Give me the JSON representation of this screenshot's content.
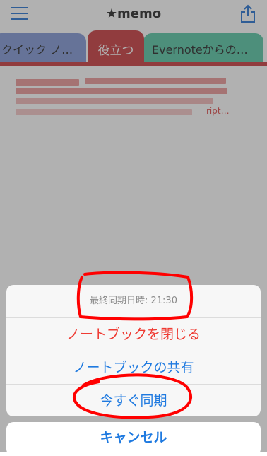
{
  "header": {
    "title": "★memo"
  },
  "tabs": [
    {
      "label": "クイック ノ…"
    },
    {
      "label": "役立つ"
    },
    {
      "label": "Evernoteからの…"
    }
  ],
  "note": {
    "snippet_end": "ript…"
  },
  "action_sheet": {
    "title": "最終同期日時: 21:30",
    "items": [
      {
        "label": "ノートブックを閉じる"
      },
      {
        "label": "ノートブックの共有"
      },
      {
        "label": "今すぐ同期"
      }
    ],
    "cancel_label": "キャンセル"
  },
  "colors": {
    "tab_active": "#c8363a",
    "tab_left": "#7f95d4",
    "tab_right": "#54c4a2",
    "action_blue": "#1f7ae0",
    "action_red": "#ef3b33",
    "annotation_red": "#ff0000"
  },
  "icons": {
    "menu": "hamburger-menu-icon",
    "share": "share-icon"
  }
}
